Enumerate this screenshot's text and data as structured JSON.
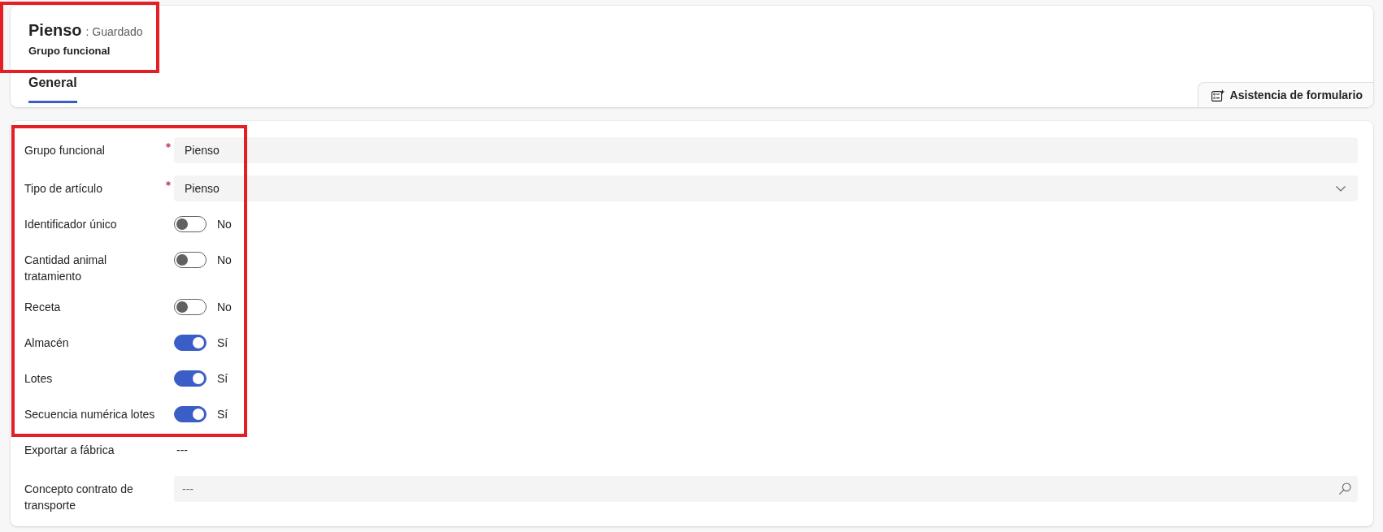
{
  "header": {
    "title": "Pienso",
    "status": ": Guardado",
    "entity": "Grupo funcional",
    "highlighted": true
  },
  "tabs": [
    {
      "label": "General",
      "selected": true
    }
  ],
  "assist_button": {
    "label": "Asistencia de formulario"
  },
  "form": {
    "groups": [
      {
        "highlighted": true,
        "fields": [
          {
            "kind": "text",
            "label": "Grupo funcional",
            "required": true,
            "value": "Pienso"
          },
          {
            "kind": "select",
            "label": "Tipo de artículo",
            "required": true,
            "value": "Pienso"
          },
          {
            "kind": "toggle",
            "label": "Identificador único",
            "required": false,
            "on": false,
            "value": "No"
          },
          {
            "kind": "toggle",
            "label": "Cantidad animal tratamiento",
            "required": false,
            "on": false,
            "value": "No"
          },
          {
            "kind": "toggle",
            "label": "Receta",
            "required": false,
            "on": false,
            "value": "No"
          },
          {
            "kind": "toggle",
            "label": "Almacén",
            "required": false,
            "on": true,
            "value": "Sí"
          },
          {
            "kind": "toggle",
            "label": "Lotes",
            "required": false,
            "on": true,
            "value": "Sí"
          },
          {
            "kind": "toggle",
            "label": "Secuencia numérica lotes",
            "required": false,
            "on": true,
            "value": "Sí"
          }
        ]
      },
      {
        "highlighted": false,
        "fields": [
          {
            "kind": "display",
            "label": "Exportar a fábrica",
            "required": false,
            "value": "---"
          },
          {
            "kind": "lookup",
            "label": "Concepto contrato de transporte",
            "required": false,
            "placeholder": "---"
          }
        ]
      }
    ]
  }
}
